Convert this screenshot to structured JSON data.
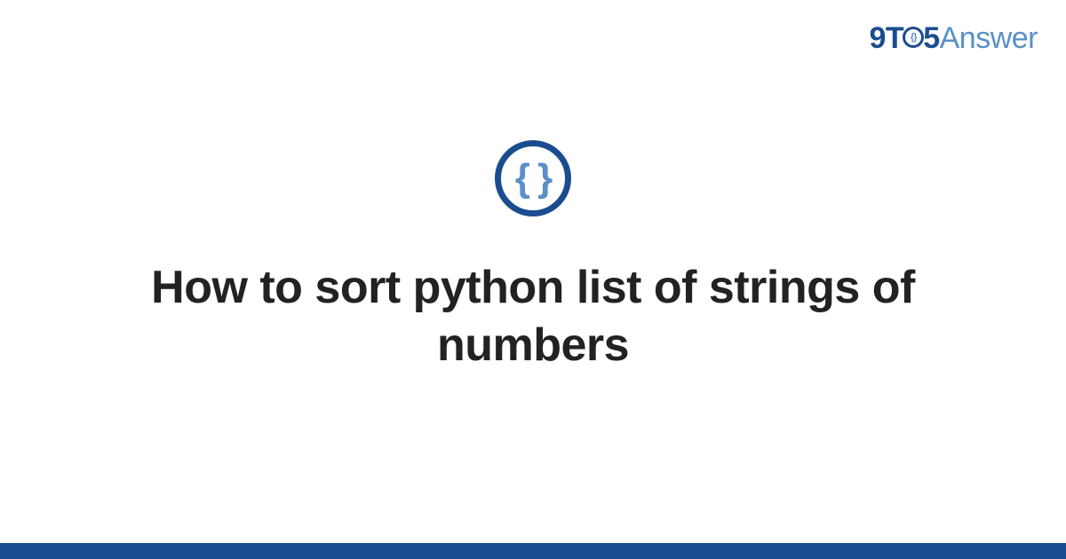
{
  "header": {
    "logo_prefix": "9T",
    "logo_middle": "5",
    "logo_suffix": "Answer"
  },
  "icon": {
    "symbol": "{ }"
  },
  "title": "How to sort python list of strings of numbers",
  "colors": {
    "brand_dark": "#1a4d8f",
    "brand_light": "#5a8fc7",
    "text": "#222222",
    "background": "#ffffff"
  }
}
